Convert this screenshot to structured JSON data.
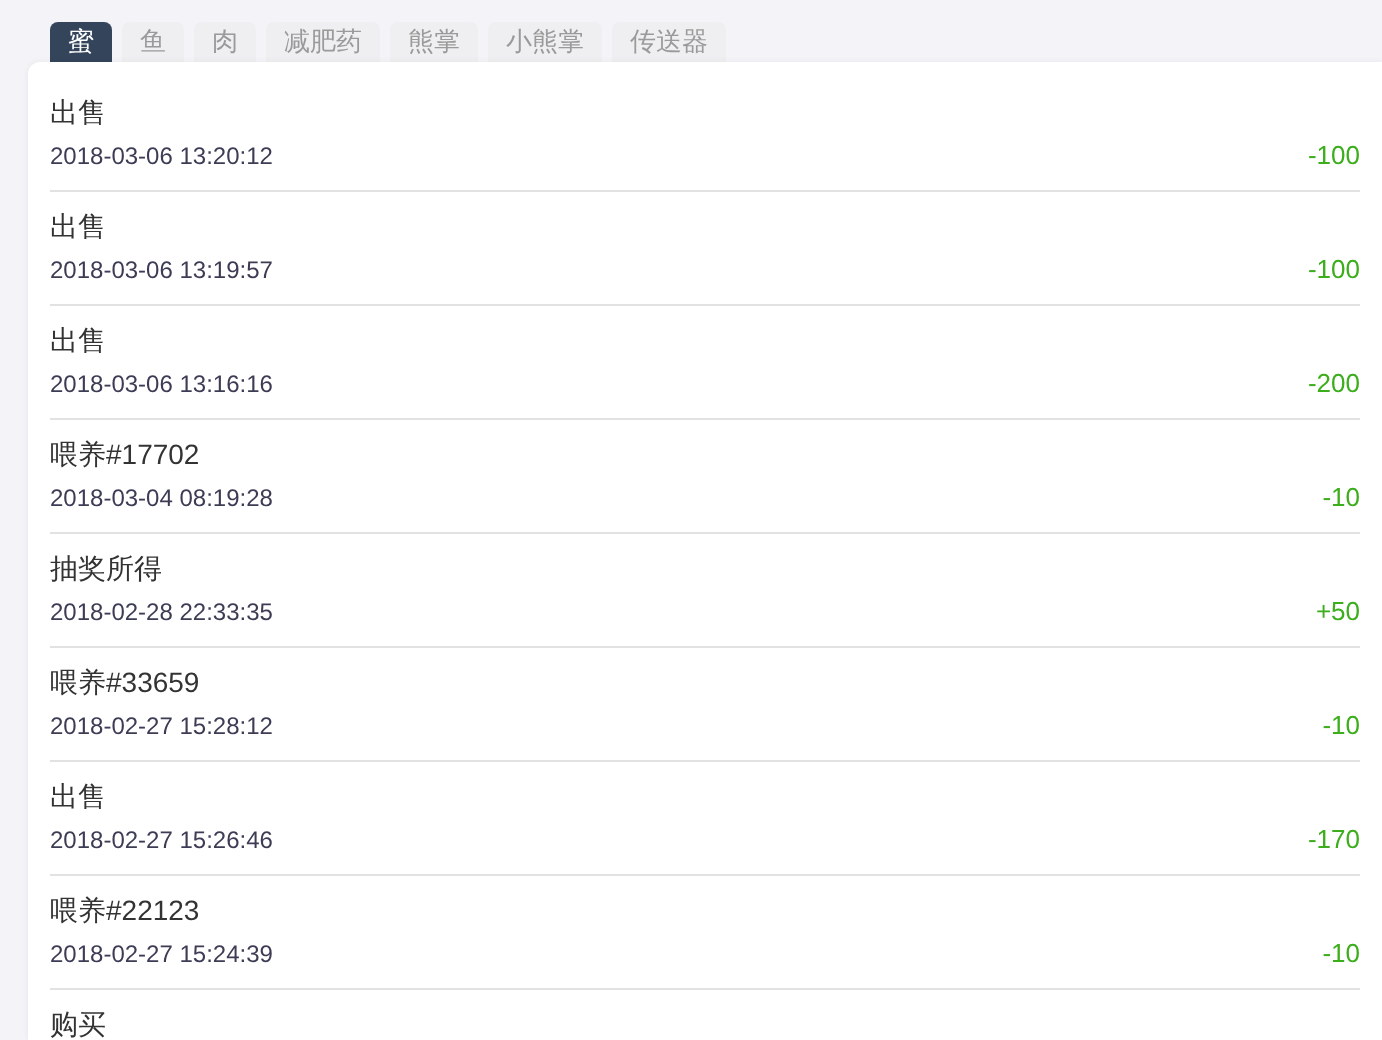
{
  "tabs": [
    {
      "label": "蜜",
      "selected": true
    },
    {
      "label": "鱼",
      "selected": false
    },
    {
      "label": "肉",
      "selected": false
    },
    {
      "label": "减肥药",
      "selected": false
    },
    {
      "label": "熊掌",
      "selected": false
    },
    {
      "label": "小熊掌",
      "selected": false
    },
    {
      "label": "传送器",
      "selected": false
    }
  ],
  "records": [
    {
      "title": "出售",
      "time": "2018-03-06 13:20:12",
      "amount": "-100"
    },
    {
      "title": "出售",
      "time": "2018-03-06 13:19:57",
      "amount": "-100"
    },
    {
      "title": "出售",
      "time": "2018-03-06 13:16:16",
      "amount": "-200"
    },
    {
      "title": "喂养#17702",
      "time": "2018-03-04 08:19:28",
      "amount": "-10"
    },
    {
      "title": "抽奖所得",
      "time": "2018-02-28 22:33:35",
      "amount": "+50"
    },
    {
      "title": "喂养#33659",
      "time": "2018-02-27 15:28:12",
      "amount": "-10"
    },
    {
      "title": "出售",
      "time": "2018-02-27 15:26:46",
      "amount": "-170"
    },
    {
      "title": "喂养#22123",
      "time": "2018-02-27 15:24:39",
      "amount": "-10"
    },
    {
      "title": "购买"
    }
  ]
}
